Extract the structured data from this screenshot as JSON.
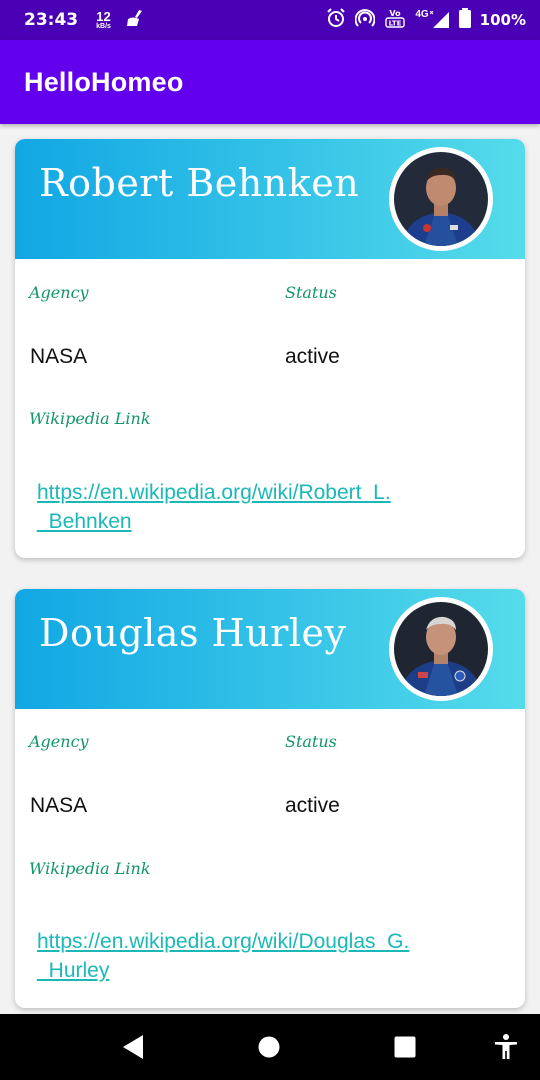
{
  "status_bar": {
    "time": "23:43",
    "net_speed": "12",
    "net_unit": "kB/s",
    "battery": "100%",
    "network": "4G",
    "icons": [
      "clean-icon",
      "alarm-icon",
      "hotspot-icon",
      "volte-icon",
      "signal-icon",
      "battery-icon"
    ]
  },
  "app_bar": {
    "title": "HelloHomeo"
  },
  "astronauts": [
    {
      "name": "Robert Behnken",
      "agency_label": "Agency",
      "agency": "NASA",
      "status_label": "Status",
      "status": "active",
      "wiki_label": "Wikipedia Link",
      "wiki_line1": "https://en.wikipedia.org/wiki/Robert_L.",
      "wiki_line2": "_Behnken"
    },
    {
      "name": "Douglas Hurley",
      "agency_label": "Agency",
      "agency": "NASA",
      "status_label": "Status",
      "status": "active",
      "wiki_label": "Wikipedia Link",
      "wiki_line1": "https://en.wikipedia.org/wiki/Douglas_G.",
      "wiki_line2": "_Hurley"
    }
  ],
  "nav_bar": {
    "icons": [
      "back-icon",
      "home-icon",
      "recents-icon",
      "accessibility-icon"
    ]
  },
  "colors": {
    "status_bar": "#4a00b4",
    "app_bar": "#6200ee",
    "header_gradient_start": "#11a7e4",
    "header_gradient_end": "#55dbea",
    "label_green": "#11956a",
    "link": "#1bb8b8"
  }
}
